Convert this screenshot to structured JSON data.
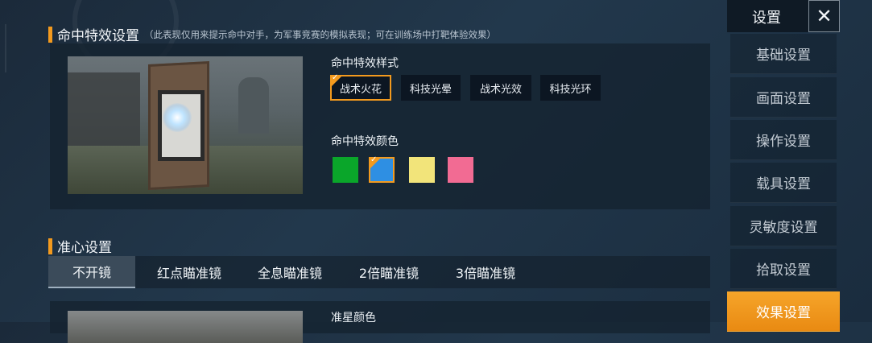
{
  "hit_effects": {
    "section_title": "命中特效设置",
    "section_note": "（此表现仅用来提示命中对手，为军事竞赛的模拟表现；可在训练场中打靶体验效果）",
    "style_label": "命中特效样式",
    "styles": [
      "战术火花",
      "科技光晕",
      "战术光效",
      "科技光环"
    ],
    "selected_style": "战术火花",
    "color_label": "命中特效颜色",
    "colors": [
      "#0aa62a",
      "#2e8fe3",
      "#f2e47a",
      "#f26b93"
    ],
    "selected_color_index": 1
  },
  "crosshair": {
    "section_title": "准心设置",
    "tabs": [
      "不开镜",
      "红点瞄准镜",
      "全息瞄准镜",
      "2倍瞄准镜",
      "3倍瞄准镜"
    ],
    "active_tab": "不开镜",
    "star_color_label": "准星颜色"
  },
  "sidebar": {
    "title": "设置",
    "close_icon": "close-icon",
    "items": [
      "基础设置",
      "画面设置",
      "操作设置",
      "载具设置",
      "灵敏度设置",
      "拾取设置",
      "效果设置"
    ],
    "active_item": "效果设置"
  },
  "accent_color": "#f39a1e"
}
